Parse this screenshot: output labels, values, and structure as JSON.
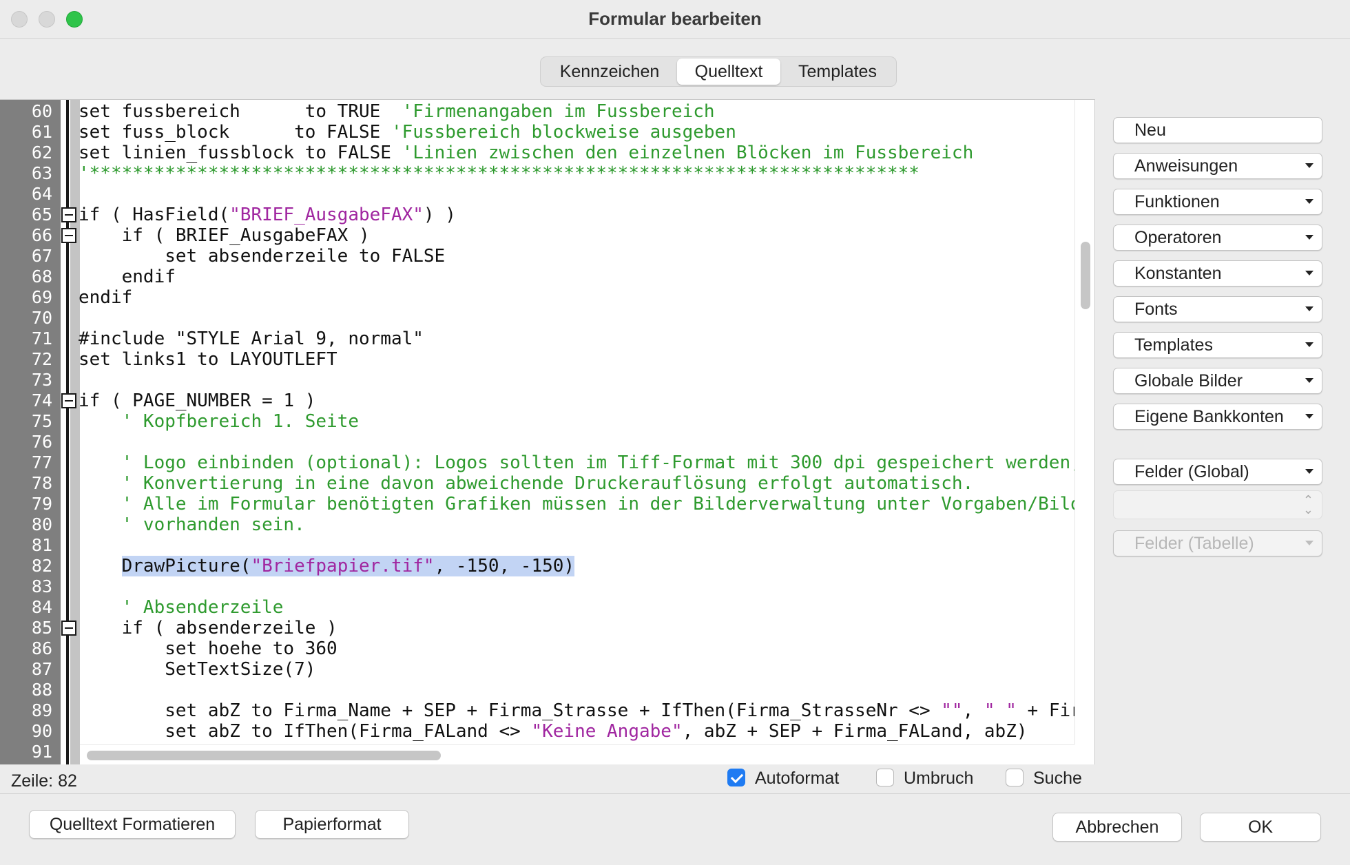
{
  "window": {
    "title": "Formular bearbeiten"
  },
  "tabs": [
    {
      "label": "Kennzeichen",
      "selected": false
    },
    {
      "label": "Quelltext",
      "selected": true
    },
    {
      "label": "Templates",
      "selected": false
    }
  ],
  "editor": {
    "lines": [
      {
        "n": "60",
        "fold": false,
        "segs": [
          [
            "c",
            "set fussbereich      to TRUE  "
          ],
          [
            "m",
            "'Firmenangaben im Fussbereich"
          ]
        ]
      },
      {
        "n": "61",
        "fold": false,
        "segs": [
          [
            "c",
            "set fuss_block      to FALSE "
          ],
          [
            "m",
            "'Fussbereich blockweise ausgeben"
          ]
        ]
      },
      {
        "n": "62",
        "fold": false,
        "segs": [
          [
            "c",
            "set linien_fussblock to FALSE "
          ],
          [
            "m",
            "'Linien zwischen den einzelnen Blöcken im Fussbereich"
          ]
        ]
      },
      {
        "n": "63",
        "fold": false,
        "segs": [
          [
            "m",
            "'*****************************************************************************"
          ]
        ]
      },
      {
        "n": "64",
        "fold": false,
        "segs": []
      },
      {
        "n": "65",
        "fold": true,
        "segs": [
          [
            "c",
            "if ( HasField("
          ],
          [
            "s",
            "\"BRIEF_AusgabeFAX\""
          ],
          [
            "c",
            ") )"
          ]
        ]
      },
      {
        "n": "66",
        "fold": true,
        "segs": [
          [
            "c",
            "    if ( BRIEF_AusgabeFAX )"
          ]
        ]
      },
      {
        "n": "67",
        "fold": false,
        "segs": [
          [
            "c",
            "        set absenderzeile to FALSE"
          ]
        ]
      },
      {
        "n": "68",
        "fold": false,
        "segs": [
          [
            "c",
            "    endif"
          ]
        ]
      },
      {
        "n": "69",
        "fold": false,
        "segs": [
          [
            "c",
            "endif"
          ]
        ]
      },
      {
        "n": "70",
        "fold": false,
        "segs": []
      },
      {
        "n": "71",
        "fold": false,
        "segs": [
          [
            "c",
            "#include \"STYLE Arial 9, normal\""
          ]
        ]
      },
      {
        "n": "72",
        "fold": false,
        "segs": [
          [
            "c",
            "set links1 to LAYOUTLEFT"
          ]
        ]
      },
      {
        "n": "73",
        "fold": false,
        "segs": []
      },
      {
        "n": "74",
        "fold": true,
        "segs": [
          [
            "c",
            "if ( PAGE_NUMBER = 1 )"
          ]
        ]
      },
      {
        "n": "75",
        "fold": false,
        "segs": [
          [
            "c",
            "    "
          ],
          [
            "m",
            "' Kopfbereich 1. Seite"
          ]
        ]
      },
      {
        "n": "76",
        "fold": false,
        "segs": []
      },
      {
        "n": "77",
        "fold": false,
        "segs": [
          [
            "c",
            "    "
          ],
          [
            "m",
            "' Logo einbinden (optional): Logos sollten im Tiff-Format mit 300 dpi gespeichert werden,"
          ]
        ]
      },
      {
        "n": "78",
        "fold": false,
        "segs": [
          [
            "c",
            "    "
          ],
          [
            "m",
            "' Konvertierung in eine davon abweichende Druckerauflösung erfolgt automatisch."
          ]
        ]
      },
      {
        "n": "79",
        "fold": false,
        "segs": [
          [
            "c",
            "    "
          ],
          [
            "m",
            "' Alle im Formular benötigten Grafiken müssen in der Bilderverwaltung unter Vorgaben/Bild"
          ]
        ]
      },
      {
        "n": "80",
        "fold": false,
        "segs": [
          [
            "c",
            "    "
          ],
          [
            "m",
            "' vorhanden sein."
          ]
        ]
      },
      {
        "n": "81",
        "fold": false,
        "segs": []
      },
      {
        "n": "82",
        "fold": false,
        "segs": [
          [
            "c",
            "    "
          ],
          [
            "cs",
            "DrawPicture("
          ],
          [
            "ss",
            "\"Briefpapier.tif\""
          ],
          [
            "cs",
            ", -150, -150)"
          ]
        ]
      },
      {
        "n": "83",
        "fold": false,
        "segs": []
      },
      {
        "n": "84",
        "fold": false,
        "segs": [
          [
            "c",
            "    "
          ],
          [
            "m",
            "' Absenderzeile"
          ]
        ]
      },
      {
        "n": "85",
        "fold": true,
        "segs": [
          [
            "c",
            "    if ( absenderzeile )"
          ]
        ]
      },
      {
        "n": "86",
        "fold": false,
        "segs": [
          [
            "c",
            "        set hoehe to 360"
          ]
        ]
      },
      {
        "n": "87",
        "fold": false,
        "segs": [
          [
            "c",
            "        SetTextSize(7)"
          ]
        ]
      },
      {
        "n": "88",
        "fold": false,
        "segs": []
      },
      {
        "n": "89",
        "fold": false,
        "segs": [
          [
            "c",
            "        set abZ to Firma_Name + SEP + Firma_Strasse + IfThen(Firma_StrasseNr <> "
          ],
          [
            "s",
            "\"\""
          ],
          [
            "c",
            ", "
          ],
          [
            "s",
            "\" \""
          ],
          [
            "c",
            " + Fir"
          ]
        ]
      },
      {
        "n": "90",
        "fold": false,
        "segs": [
          [
            "c",
            "        set abZ to IfThen(Firma_FALand <> "
          ],
          [
            "s",
            "\"Keine Angabe\""
          ],
          [
            "c",
            ", abZ + SEP + Firma_FALand, abZ)"
          ]
        ]
      },
      {
        "n": "91",
        "fold": false,
        "segs": []
      }
    ]
  },
  "status": {
    "line_label": "Zeile: 82",
    "autoformat_label": "Autoformat",
    "autoformat_checked": true,
    "umbruch_label": "Umbruch",
    "umbruch_checked": false,
    "suche_label": "Suche",
    "suche_checked": false
  },
  "side": {
    "neu": "Neu",
    "anweisungen": "Anweisungen",
    "funktionen": "Funktionen",
    "operatoren": "Operatoren",
    "konstanten": "Konstanten",
    "fonts": "Fonts",
    "templates": "Templates",
    "globale_bilder": "Globale Bilder",
    "eigene_bankkonten": "Eigene Bankkonten",
    "felder_global": "Felder (Global)",
    "felder_tabelle": "Felder (Tabelle)"
  },
  "bottom": {
    "format": "Quelltext Formatieren",
    "papier": "Papierformat",
    "cancel": "Abbrechen",
    "ok": "OK"
  },
  "colors": {
    "comment": "#2e9a2e",
    "string": "#a026a0",
    "selection": "#c2d4f4",
    "gutter": "#7f7f7f",
    "accent": "#1f7bf2"
  },
  "icons": {
    "fold": "fold-minus-icon",
    "dropdown": "chevron-down-icon",
    "stepper": "up-down-chevron-icon"
  }
}
